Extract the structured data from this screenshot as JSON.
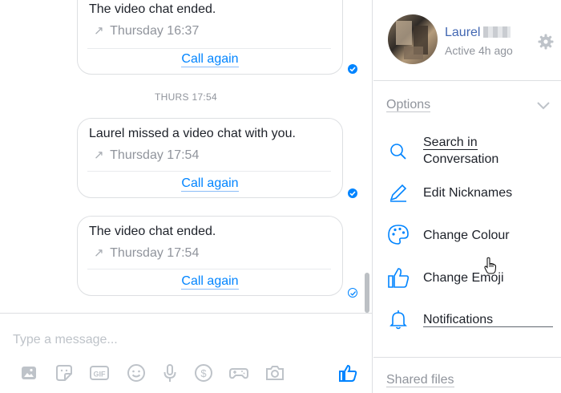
{
  "chat": {
    "cards": [
      {
        "title": "The video chat ended.",
        "time": "Thursday 16:37",
        "action": "Call again"
      },
      {
        "title": "Laurel missed a video chat with you.",
        "time": "Thursday 17:54",
        "action": "Call again"
      },
      {
        "title": "The video chat ended.",
        "time": "Thursday 17:54",
        "action": "Call again"
      }
    ],
    "timestamp": "THURS 17:54",
    "arrow_glyph": "↗"
  },
  "composer": {
    "placeholder": "Type a message...",
    "tools": [
      "image-icon",
      "sticker-icon",
      "gif-icon",
      "emoji-icon",
      "microphone-icon",
      "payment-icon",
      "game-controller-icon",
      "camera-icon",
      "thumbs-up-icon"
    ],
    "gif_label": "GIF"
  },
  "profile": {
    "name": "Laurel",
    "status": "Active 4h ago"
  },
  "options": {
    "title": "Options",
    "items": [
      {
        "label_line1": "Search in",
        "label_line2": "Conversation",
        "icon": "search-icon"
      },
      {
        "label_line1": "Edit Nicknames",
        "icon": "pencil-icon"
      },
      {
        "label_line1": "Change Colour",
        "icon": "palette-icon"
      },
      {
        "label_line1": "Change Emoji",
        "icon": "thumbs-up-icon"
      },
      {
        "label_line1": "Notifications",
        "icon": "bell-icon"
      }
    ]
  },
  "shared_files": {
    "title": "Shared files"
  },
  "colors": {
    "accent": "#0084ff",
    "link": "#4267b2",
    "muted": "#90949c",
    "border": "#dddfe2"
  }
}
